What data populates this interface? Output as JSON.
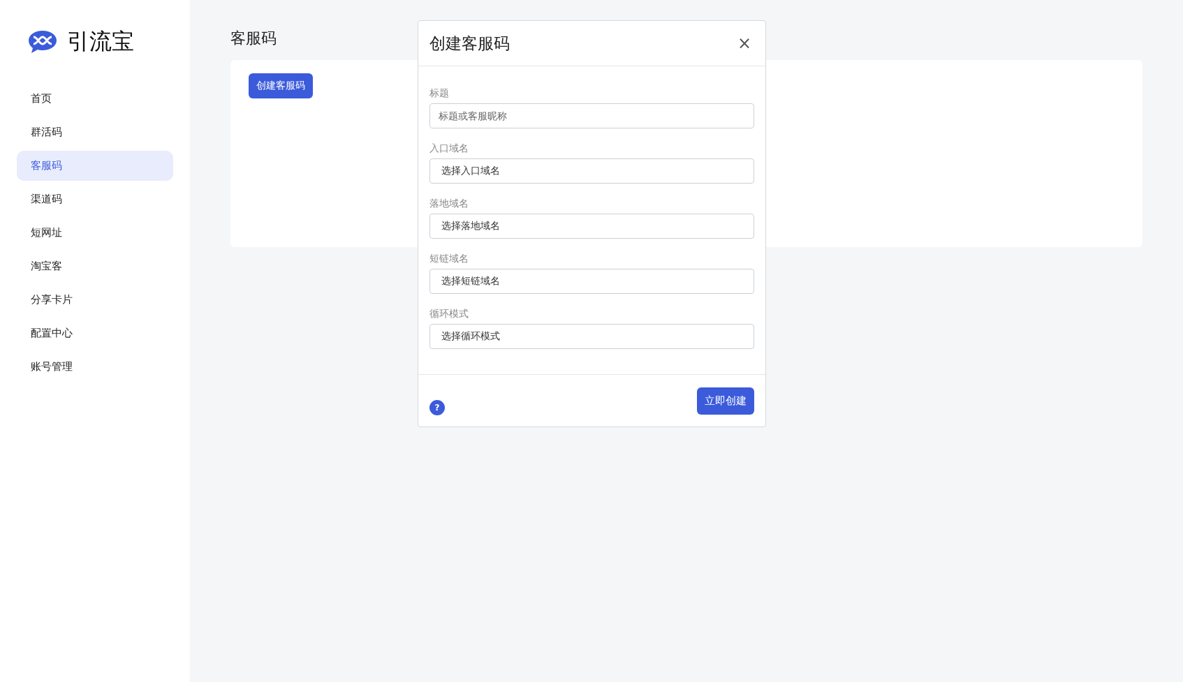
{
  "brand": {
    "name": "引流宝"
  },
  "sidebar": {
    "items": [
      {
        "label": "首页",
        "selected": false
      },
      {
        "label": "群活码",
        "selected": false
      },
      {
        "label": "客服码",
        "selected": true
      },
      {
        "label": "渠道码",
        "selected": false
      },
      {
        "label": "短网址",
        "selected": false
      },
      {
        "label": "淘宝客",
        "selected": false
      },
      {
        "label": "分享卡片",
        "selected": false
      },
      {
        "label": "配置中心",
        "selected": false
      },
      {
        "label": "账号管理",
        "selected": false
      }
    ]
  },
  "page": {
    "title": "客服码",
    "create_button": "创建客服码"
  },
  "modal": {
    "title": "创建客服码",
    "close": "×",
    "fields": [
      {
        "kind": "input",
        "label": "标题",
        "placeholder": "标题或客服昵称"
      },
      {
        "kind": "select",
        "label": "入口域名",
        "value": "选择入口域名"
      },
      {
        "kind": "select",
        "label": "落地域名",
        "value": "选择落地域名"
      },
      {
        "kind": "select",
        "label": "短链域名",
        "value": "选择短链域名"
      },
      {
        "kind": "select",
        "label": "循环模式",
        "value": "选择循环模式"
      }
    ],
    "help": "?",
    "submit": "立即创建"
  }
}
